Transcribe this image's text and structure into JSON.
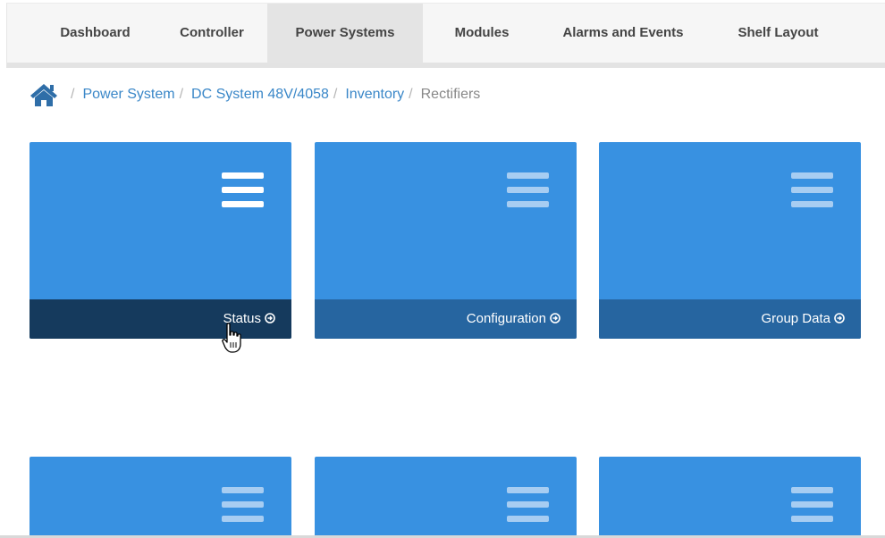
{
  "nav": {
    "tabs": [
      {
        "label": "Dashboard",
        "active": false
      },
      {
        "label": "Controller",
        "active": false
      },
      {
        "label": "Power Systems",
        "active": true
      },
      {
        "label": "Modules",
        "active": false
      },
      {
        "label": "Alarms and Events",
        "active": false
      },
      {
        "label": "Shelf Layout",
        "active": false
      }
    ]
  },
  "breadcrumb": {
    "home_icon": "home-icon",
    "separator": "/",
    "items": [
      {
        "label": "Power System"
      },
      {
        "label": "DC System 48V/4058"
      },
      {
        "label": "Inventory"
      },
      {
        "label": "Rectifiers"
      }
    ]
  },
  "tiles": [
    {
      "label": "Status",
      "icon": "menu-icon",
      "footer_icon": "arrow-circle-right-icon",
      "state": "hover"
    },
    {
      "label": "Configuration",
      "icon": "menu-icon",
      "footer_icon": "arrow-circle-right-icon",
      "state": "normal"
    },
    {
      "label": "Group Data",
      "icon": "menu-icon",
      "footer_icon": "arrow-circle-right-icon",
      "state": "normal"
    },
    {
      "label": "",
      "icon": "menu-icon"
    },
    {
      "label": "",
      "icon": "menu-icon"
    },
    {
      "label": "",
      "icon": "menu-icon"
    }
  ],
  "colors": {
    "tile": "#3891e1",
    "footer_hover": "#153a5d",
    "footer_normal": "#2665a0",
    "link": "#3a87c8"
  }
}
